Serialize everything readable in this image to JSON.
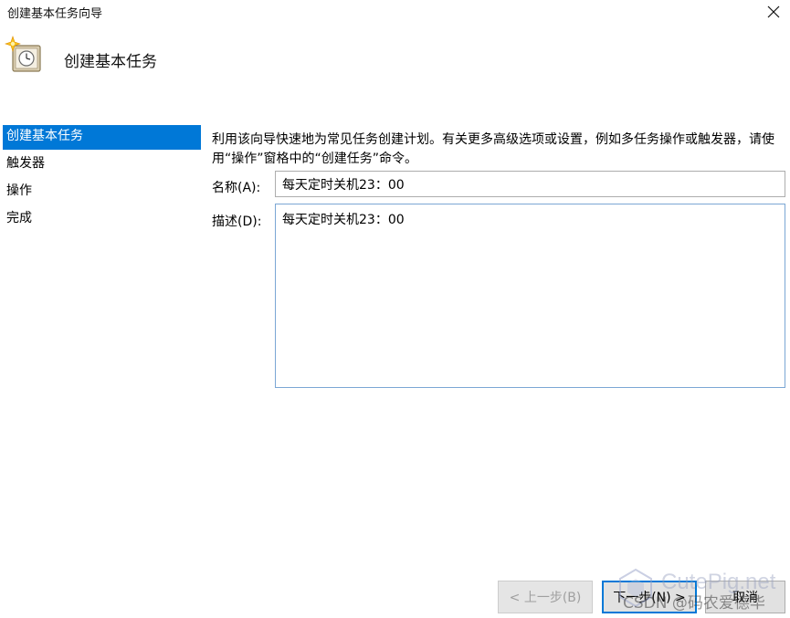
{
  "window": {
    "title": "创建基本任务向导",
    "close_glyph": "✕"
  },
  "header": {
    "title": "创建基本任务",
    "icon": "task-scheduler-clock-icon"
  },
  "sidebar": {
    "items": [
      {
        "label": "创建基本任务",
        "active": true
      },
      {
        "label": "触发器",
        "active": false
      },
      {
        "label": "操作",
        "active": false
      },
      {
        "label": "完成",
        "active": false
      }
    ]
  },
  "main": {
    "description": "利用该向导快速地为常见任务创建计划。有关更多高级选项或设置，例如多任务操作或触发器，请使用“操作”窗格中的“创建任务”命令。",
    "name_label": "名称(A):",
    "name_value": "每天定时关机23：00",
    "desc_label": "描述(D):",
    "desc_value": "每天定时关机23：00"
  },
  "buttons": {
    "back": "< 上一步(B)",
    "next": "下一步(N) >",
    "cancel": "取消"
  },
  "watermark": {
    "brand": "CutePig.net",
    "credit": "CSDN @码农爱德华"
  },
  "colors": {
    "accent": "#0078d7",
    "selected_text": "#ffffff",
    "disabled_text": "#a0a0a0"
  }
}
